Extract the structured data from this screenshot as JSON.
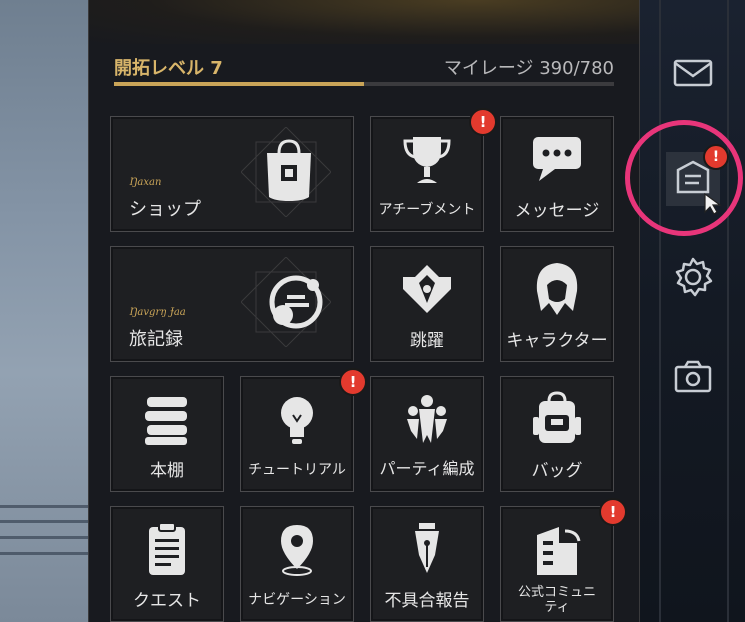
{
  "header": {
    "level_label": "開拓レベル 7",
    "mileage_label": "マイレージ 390/780",
    "mileage_current": 390,
    "mileage_max": 780
  },
  "tiles": {
    "shop": {
      "label": "ショップ",
      "sub": "Ŋaxan"
    },
    "achievement": {
      "label": "アチーブメント",
      "badge": "!"
    },
    "message": {
      "label": "メッセージ"
    },
    "travel_log": {
      "label": "旅記録",
      "sub": "Ŋavgrŋ Ɉaa"
    },
    "warp": {
      "label": "跳躍"
    },
    "character": {
      "label": "キャラクター"
    },
    "bookshelf": {
      "label": "本棚"
    },
    "tutorial": {
      "label": "チュートリアル",
      "badge": "!"
    },
    "party": {
      "label": "パーティ編成"
    },
    "bag": {
      "label": "バッグ"
    },
    "quest": {
      "label": "クエスト"
    },
    "navigation": {
      "label": "ナビゲーション"
    },
    "report": {
      "label": "不具合報告"
    },
    "community": {
      "label_line1": "公式コミュニ",
      "label_line2": "ティ",
      "badge": "!"
    }
  },
  "sidebar": {
    "mail_icon": "mail-icon",
    "notice_icon": "notice-icon",
    "notice_badge": "!",
    "settings_icon": "gear-icon",
    "camera_icon": "camera-icon"
  },
  "colors": {
    "accent_gold": "#c9a458",
    "badge_red": "#e23a2e",
    "highlight_pink": "#e8357a"
  }
}
